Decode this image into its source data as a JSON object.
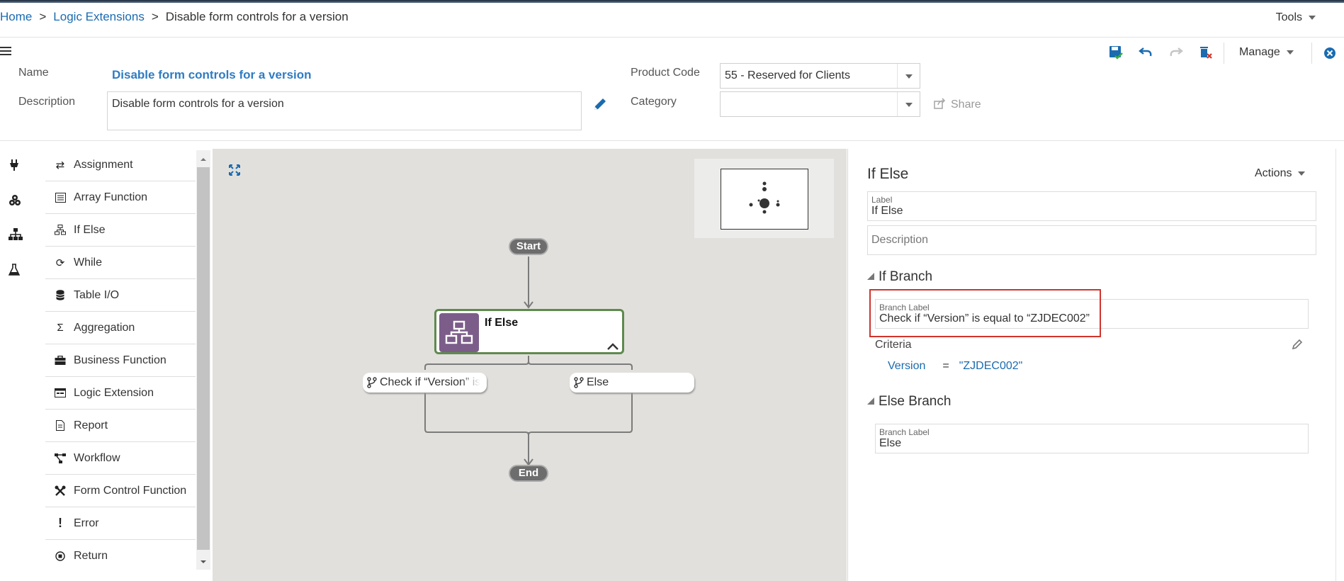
{
  "breadcrumb": {
    "home": "Home",
    "sep": ">",
    "logic_extensions": "Logic Extensions",
    "current": "Disable form controls for a version"
  },
  "header": {
    "tools_label": "Tools",
    "manage_label": "Manage",
    "share_label": "Share"
  },
  "form": {
    "name_label": "Name",
    "name_value": "Disable form controls for a version",
    "description_label": "Description",
    "description_value": "Disable form controls for a version",
    "product_code_label": "Product Code",
    "product_code_value": "55 - Reserved for Clients",
    "category_label": "Category",
    "category_value": ""
  },
  "palette": {
    "items": [
      {
        "label": "Assignment",
        "icon": "arrows-exchange-icon"
      },
      {
        "label": "Array Function",
        "icon": "list-icon"
      },
      {
        "label": "If Else",
        "icon": "hierarchy-icon"
      },
      {
        "label": "While",
        "icon": "loop-icon"
      },
      {
        "label": "Table I/O",
        "icon": "database-icon"
      },
      {
        "label": "Aggregation",
        "icon": "sigma-icon"
      },
      {
        "label": "Business Function",
        "icon": "briefcase-icon"
      },
      {
        "label": "Logic Extension",
        "icon": "window-icon"
      },
      {
        "label": "Report",
        "icon": "document-icon"
      },
      {
        "label": "Workflow",
        "icon": "workflow-icon"
      },
      {
        "label": "Form Control Function",
        "icon": "tools-icon"
      },
      {
        "label": "Error",
        "icon": "exclamation-icon"
      },
      {
        "label": "Return",
        "icon": "return-icon"
      }
    ]
  },
  "canvas": {
    "start_label": "Start",
    "end_label": "End",
    "node_label": "If Else",
    "branch1_label": "Check if “Version” is",
    "branch2_label": "Else"
  },
  "panel": {
    "title": "If Else",
    "actions_label": "Actions",
    "label_field_label": "Label",
    "label_field_value": "If Else",
    "description_placeholder": "Description",
    "if_branch_title": "If Branch",
    "branch_label_label": "Branch Label",
    "if_branch_label_value": "Check if “Version” is equal to “ZJDEC002”",
    "criteria_label": "Criteria",
    "criteria_field": "Version",
    "criteria_operator": "=",
    "criteria_value": "\"ZJDEC002\"",
    "else_branch_title": "Else Branch",
    "else_branch_label_value": "Else"
  },
  "colors": {
    "accent": "#1a6bb0",
    "node_badge": "#7c5d8a",
    "node_border": "#5e8a4e",
    "highlight": "#d0342c"
  }
}
